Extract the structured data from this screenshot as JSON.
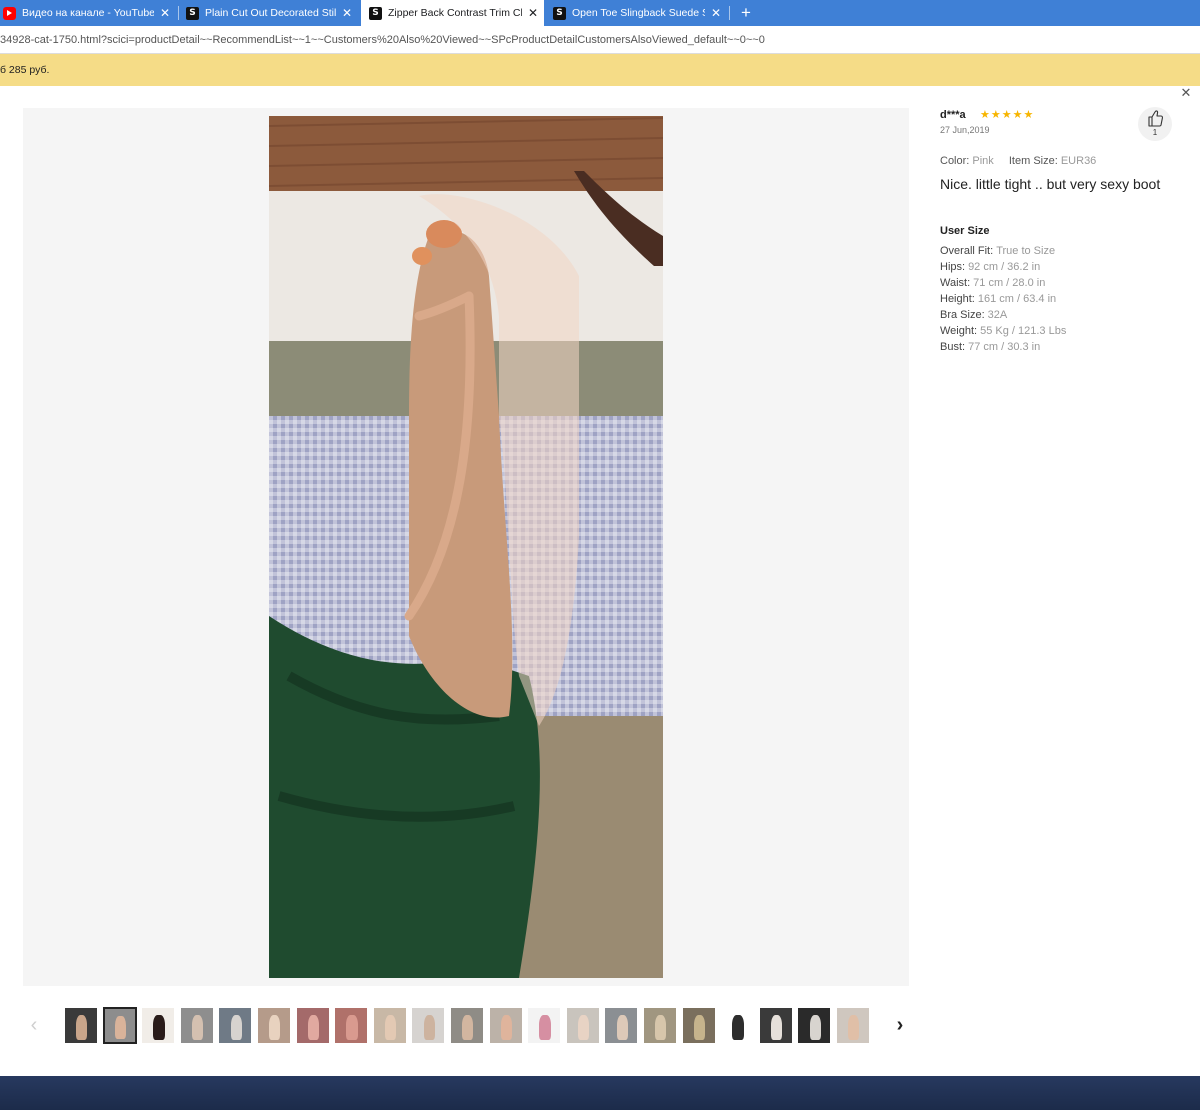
{
  "browser": {
    "tabs": [
      {
        "title": "Видео на канале - YouTube Studio",
        "favicon": "youtube-icon",
        "active": false
      },
      {
        "title": "Plain Cut Out Decorated Stiletto Heels",
        "favicon": "shein-s-icon",
        "active": false
      },
      {
        "title": "Zipper Back Contrast Trim Clear Heels",
        "favicon": "shein-s-icon",
        "active": true
      },
      {
        "title": "Open Toe Slingback Suede Stiletto Heels",
        "favicon": "shein-s-icon",
        "active": false
      }
    ],
    "shein_letter": "S",
    "close_glyph": "✕",
    "new_tab_glyph": "+",
    "url": "34928-cat-1750.html?scici=productDetail~~RecommendList~~1~~Customers%20Also%20Viewed~~SPcProductDetailCustomersAlsoViewed_default~~0~~0"
  },
  "banner": {
    "text": "б 285 руб."
  },
  "modal": {
    "close_glyph": "✕",
    "review": {
      "reviewer": "d***a",
      "rating": 5,
      "star_glyph": "★",
      "date": "27 Jun,2019",
      "like_count": "1",
      "color_label": "Color:",
      "color_value": "Pink",
      "size_label": "Item Size:",
      "size_value": "EUR36",
      "comment": "Nice. little tight .. but very sexy boot"
    },
    "user_size": {
      "title": "User Size",
      "rows": [
        {
          "label": "Overall Fit:",
          "value": "True to Size"
        },
        {
          "label": "Hips:",
          "value": "92 cm / 36.2 in"
        },
        {
          "label": "Waist:",
          "value": "71 cm / 28.0 in"
        },
        {
          "label": "Height:",
          "value": "161 cm / 63.4 in"
        },
        {
          "label": "Bra Size:",
          "value": "32A"
        },
        {
          "label": "Weight:",
          "value": "55 Kg / 121.3 Lbs"
        },
        {
          "label": "Bust:",
          "value": "77 cm / 30.3 in"
        }
      ]
    },
    "thumbnails": {
      "prev_glyph": "‹",
      "next_glyph": "›",
      "selected_index": 1,
      "colors": [
        [
          "#3a3a3a",
          "#c9a58a"
        ],
        [
          "#8d8d8d",
          "#d9b39a"
        ],
        [
          "#f1ede8",
          "#2a1c1a"
        ],
        [
          "#8e8e8e",
          "#d4c0b0"
        ],
        [
          "#6f7a86",
          "#d7d3cf"
        ],
        [
          "#b59b8a",
          "#e8d2bf"
        ],
        [
          "#a46a6a",
          "#e1a9a0"
        ],
        [
          "#b0716a",
          "#d99a8f"
        ],
        [
          "#c8b8a6",
          "#e3c9b3"
        ],
        [
          "#d6d3d0",
          "#cdb39f"
        ],
        [
          "#8f8c86",
          "#d2b6a0"
        ],
        [
          "#bcb2a8",
          "#dfb49c"
        ],
        [
          "#f3f3f3",
          "#d68fa2"
        ],
        [
          "#c9c4bd",
          "#e8d3c4"
        ],
        [
          "#8b8f93",
          "#ddc9b8"
        ],
        [
          "#a09680",
          "#d7c6ab"
        ],
        [
          "#7a6f5d",
          "#c6b48c"
        ],
        [
          "#ffffff",
          "#2d2d2d"
        ],
        [
          "#3a3a3a",
          "#e6e0da"
        ],
        [
          "#2a2a2a",
          "#d8d4cf"
        ],
        [
          "#cfc7bf",
          "#e0bfa7"
        ]
      ]
    }
  }
}
